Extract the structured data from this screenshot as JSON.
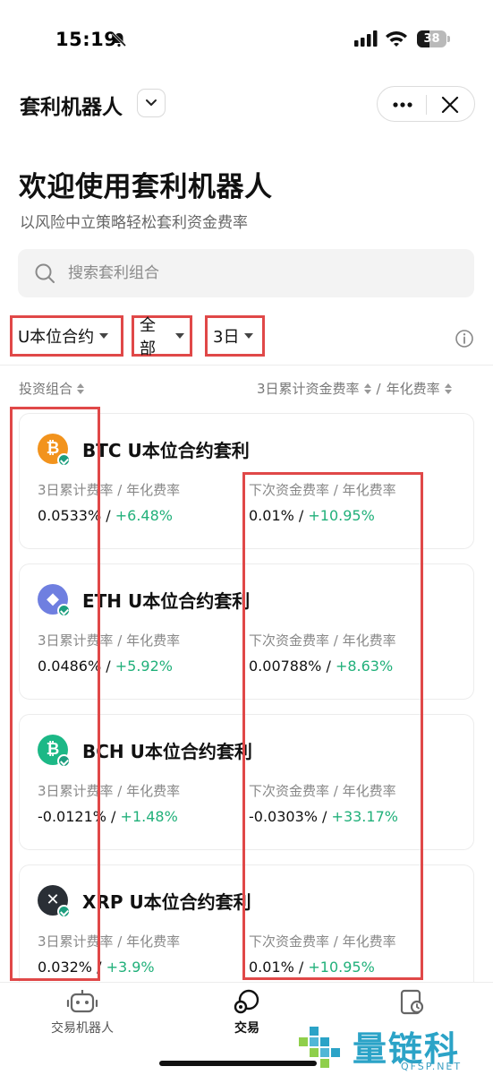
{
  "status_bar": {
    "time": "15:19",
    "battery": "38"
  },
  "header": {
    "title": "套利机器人"
  },
  "hero": {
    "title": "欢迎使用套利机器人",
    "subtitle": "以风险中立策略轻松套利资金费率"
  },
  "search": {
    "placeholder": "搜索套利组合"
  },
  "filters": [
    {
      "label": "U本位合约"
    },
    {
      "label": "全部"
    },
    {
      "label": "3日"
    }
  ],
  "columns": {
    "left": "投资组合",
    "right_a": "3日累计资金费率",
    "right_sep": "/",
    "right_b": "年化费率"
  },
  "cards": [
    {
      "title": "BTC U本位合约套利",
      "coin_symbol": "₿",
      "coin_color": "#f2931d",
      "label_left": "3日累计费率 / 年化费率",
      "label_right": "下次资金费率 / 年化费率",
      "left_rate": "0.0533%",
      "left_annual": "+6.48%",
      "right_rate": "0.01%",
      "right_annual": "+10.95%"
    },
    {
      "title": "ETH U本位合约套利",
      "coin_symbol": "◆",
      "coin_color": "#6f7fe0",
      "label_left": "3日累计费率 / 年化费率",
      "label_right": "下次资金费率 / 年化费率",
      "left_rate": "0.0486%",
      "left_annual": "+5.92%",
      "right_rate": "0.00788%",
      "right_annual": "+8.63%"
    },
    {
      "title": "BCH U本位合约套利",
      "coin_symbol": "₿",
      "coin_color": "#1cb886",
      "label_left": "3日累计费率 / 年化费率",
      "label_right": "下次资金费率 / 年化费率",
      "left_rate": "-0.0121%",
      "left_annual": "+1.48%",
      "right_rate": "-0.0303%",
      "right_annual": "+33.17%"
    },
    {
      "title": "XRP U本位合约套利",
      "coin_symbol": "✕",
      "coin_color": "#2a2f36",
      "label_left": "3日累计费率 / 年化费率",
      "label_right": "下次资金费率 / 年化费率",
      "left_rate": "0.032%",
      "left_annual": "+3.9%",
      "right_rate": "0.01%",
      "right_annual": "+10.95%"
    }
  ],
  "tabbar": {
    "tab1": "交易机器人",
    "tab2": "交易",
    "tab3": ""
  },
  "watermark": {
    "text": "量链科技",
    "sub": "QFSP.NET"
  },
  "colors": {
    "accent_green": "#21b07a",
    "annotation_red": "#e04848"
  }
}
